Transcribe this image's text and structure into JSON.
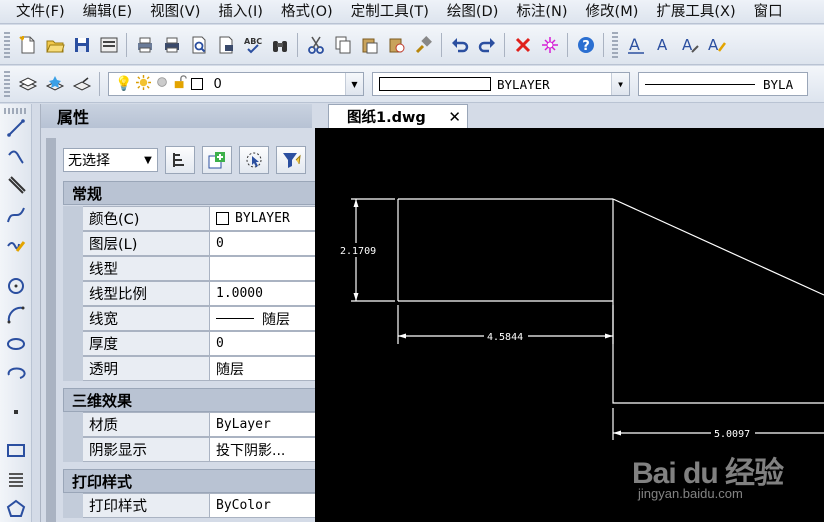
{
  "menu": [
    "文件(F)",
    "编辑(E)",
    "视图(V)",
    "插入(I)",
    "格式(O)",
    "定制工具(T)",
    "绘图(D)",
    "标注(N)",
    "修改(M)",
    "扩展工具(X)",
    "窗口"
  ],
  "layer_toolbar": {
    "layer_name": "0",
    "color": "BYLAYER",
    "linetype": "BYLA"
  },
  "properties": {
    "title": "属性",
    "selection": "无选择",
    "sections": {
      "general": {
        "title": "常规",
        "rows": [
          {
            "name": "颜色(C)",
            "value": "BYLAYER"
          },
          {
            "name": "图层(L)",
            "value": "0"
          },
          {
            "name": "线型",
            "value": ""
          },
          {
            "name": "线型比例",
            "value": "1.0000"
          },
          {
            "name": "线宽",
            "value": "随层"
          },
          {
            "name": "厚度",
            "value": "0"
          },
          {
            "name": "透明",
            "value": "随层"
          }
        ]
      },
      "three_d": {
        "title": "三维效果",
        "rows": [
          {
            "name": "材质",
            "value": "ByLayer"
          },
          {
            "name": "阴影显示",
            "value": "投下阴影..."
          }
        ]
      },
      "plot_style": {
        "title": "打印样式",
        "rows": [
          {
            "name": "打印样式",
            "value": "ByColor"
          }
        ]
      }
    }
  },
  "document_tab": {
    "label": "图纸1.dwg",
    "close": "✕"
  },
  "drawing": {
    "dim_vertical": "2.1709",
    "dim_horizontal_1": "4.5844",
    "dim_horizontal_2": "5.0097"
  },
  "watermark": {
    "logo": "Bai du 经验",
    "url": "jingyan.baidu.com"
  },
  "colors": {
    "canvas": "#000000",
    "panel": "#d4dbe7",
    "section_header": "#b9c3d3"
  }
}
